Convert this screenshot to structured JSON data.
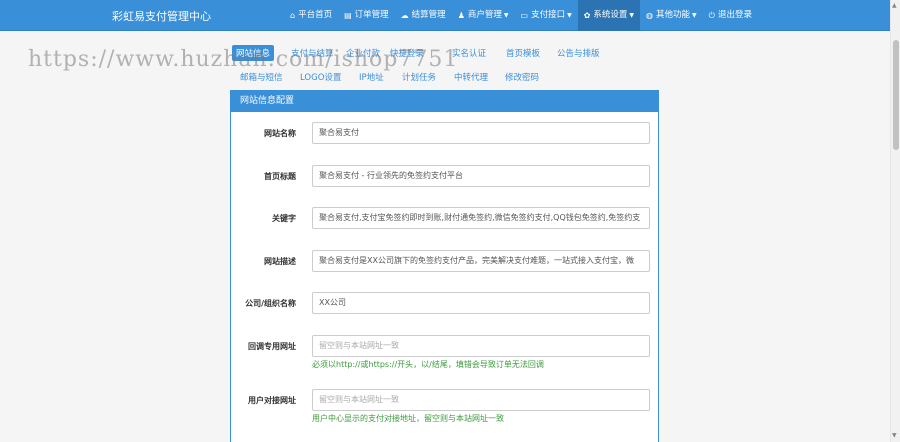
{
  "navbar": {
    "brand": "彩虹易支付管理中心",
    "items": [
      {
        "label": "平台首页",
        "icon": "home-icon",
        "glyph": "⌂",
        "dropdown": false,
        "active": false
      },
      {
        "label": "订单管理",
        "icon": "list-icon",
        "glyph": "▤",
        "dropdown": false,
        "active": false
      },
      {
        "label": "结算管理",
        "icon": "cloud-icon",
        "glyph": "☁",
        "dropdown": false,
        "active": false
      },
      {
        "label": "商户管理",
        "icon": "user-icon",
        "glyph": "♟",
        "dropdown": true,
        "active": false
      },
      {
        "label": "支付接口",
        "icon": "card-icon",
        "glyph": "▭",
        "dropdown": true,
        "active": false
      },
      {
        "label": "系统设置",
        "icon": "gear-icon",
        "glyph": "✿",
        "dropdown": true,
        "active": true
      },
      {
        "label": "其他功能",
        "icon": "globe-icon",
        "glyph": "◍",
        "dropdown": true,
        "active": false
      },
      {
        "label": "退出登录",
        "icon": "power-icon",
        "glyph": "⏻",
        "dropdown": false,
        "active": false
      }
    ]
  },
  "tabs": {
    "row1": [
      "网站信息",
      "支付与结算",
      "企业付款",
      "快捷登录",
      "实名认证",
      "首页模板",
      "公告与排版"
    ],
    "row2": [
      "邮箱与短信",
      "LOGO设置",
      "IP地址",
      "计划任务",
      "中转代理",
      "修改密码"
    ]
  },
  "watermark": "https://www.huzhan.com/ishop7751",
  "panel": {
    "heading": "网站信息配置",
    "fields": [
      {
        "label": "网站名称",
        "value": "聚合易支付",
        "placeholder": "",
        "help": ""
      },
      {
        "label": "首页标题",
        "value": "聚合易支付 - 行业领先的免签约支付平台",
        "placeholder": "",
        "help": ""
      },
      {
        "label": "关键字",
        "value": "聚合易支付,支付宝免签约即时到账,财付通免签约,微信免签约支付,QQ钱包免签约,免签约支",
        "placeholder": "",
        "help": ""
      },
      {
        "label": "网站描述",
        "value": "聚合易支付是XX公司旗下的免签约支付产品，完美解决支付难题，一站式接入支付宝，微",
        "placeholder": "",
        "help": ""
      },
      {
        "label": "公司/组织名称",
        "value": "XX公司",
        "placeholder": "",
        "help": ""
      },
      {
        "label": "回调专用网址",
        "value": "",
        "placeholder": "留空则与本站网址一致",
        "help": "必须以http://或https://开头，以/结尾，填错会导致订单无法回调"
      },
      {
        "label": "用户对接网址",
        "value": "",
        "placeholder": "留空则与本站网址一致",
        "help": "用户中心显示的支付对接地址，留空则与本站网址一致"
      }
    ]
  }
}
